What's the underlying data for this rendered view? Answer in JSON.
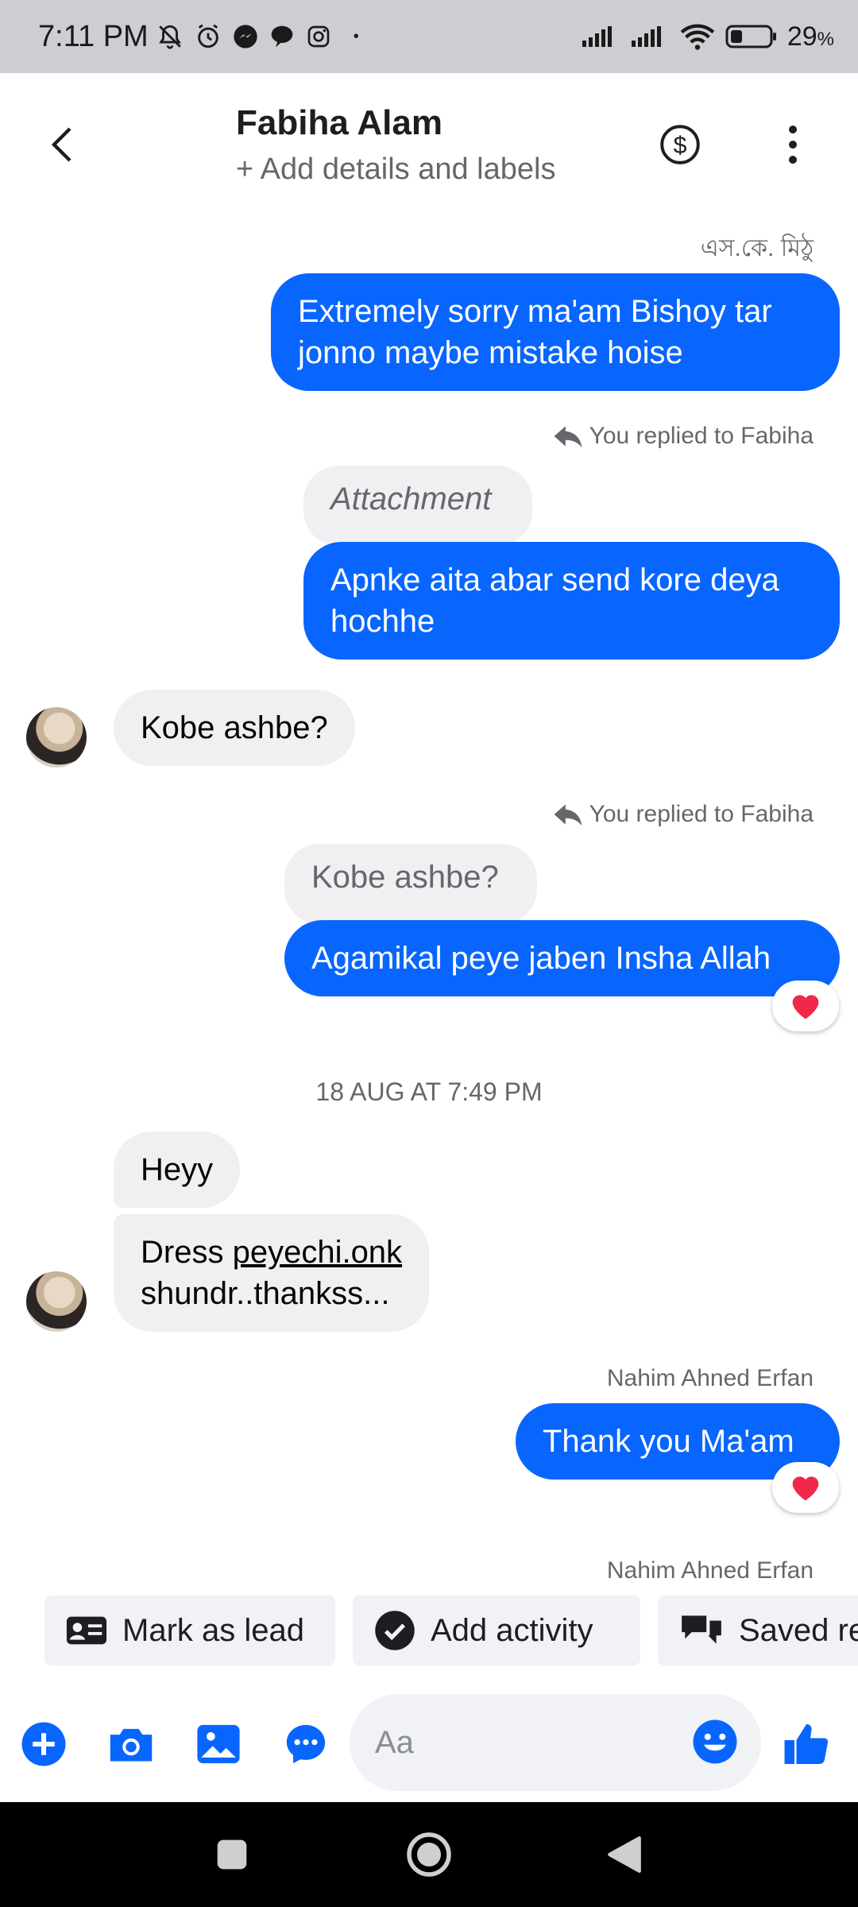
{
  "status_bar": {
    "time": "7:11 PM",
    "battery": "29",
    "battery_unit": "%",
    "dot": "•"
  },
  "header": {
    "back_icon": "chevron-left-icon",
    "contact_name": "Fabiha Alam",
    "subtitle": "+ Add details and labels",
    "dollar_icon": "dollar-circle-icon",
    "more_icon": "more-vertical-icon"
  },
  "messages": {
    "m1": {
      "sender": "এস.কে. মিঠু",
      "text": "Extremely sorry ma'am Bishoy tar jonno maybe mistake hoise"
    },
    "m2": {
      "replied_label": "You replied to Fabiha",
      "quoted": "Attachment",
      "text": "Apnke aita abar send kore deya hochhe"
    },
    "m3": {
      "text": "Kobe ashbe?"
    },
    "m4": {
      "replied_label": "You replied to Fabiha",
      "quoted": "Kobe ashbe?",
      "text": "Agamikal peye jaben Insha Allah",
      "reaction": "❤"
    },
    "date_separator": "18 AUG AT 7:49 PM",
    "m5": {
      "text": "Heyy"
    },
    "m6": {
      "text_plain": "Dress ",
      "text_link": "peyechi.onk",
      "text_line2": "shundr..thankss..."
    },
    "m7": {
      "sender": "Nahim Ahned Erfan",
      "text": "Thank you Ma'am",
      "reaction": "❤"
    },
    "m8": {
      "sender": "Nahim Ahned Erfan"
    }
  },
  "quick_actions": {
    "mark_as_lead": "Mark as lead",
    "add_activity": "Add activity",
    "saved_replies": "Saved re"
  },
  "composer": {
    "placeholder": "Aa",
    "icons": [
      "plus-icon",
      "camera-icon",
      "gallery-icon",
      "chat-bubble-icon",
      "emoji-icon",
      "thumbs-up-icon"
    ]
  },
  "colors": {
    "accent": "#0866ff",
    "incoming_bubble": "#f0f0f2",
    "status_bar": "#ccced2",
    "reaction_heart": "#f02849"
  }
}
